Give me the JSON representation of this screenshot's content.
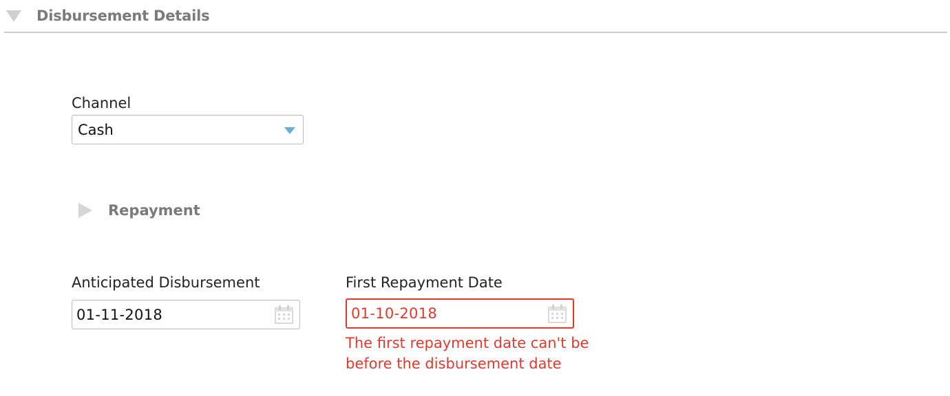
{
  "section": {
    "title": "Disbursement Details",
    "expanded_icon": "triangle-down-icon"
  },
  "channel": {
    "label": "Channel",
    "selected": "Cash",
    "caret_icon": "chevron-down-icon"
  },
  "repayment_section": {
    "title": "Repayment",
    "collapsed_icon": "triangle-right-icon"
  },
  "anticipated_disbursement": {
    "label": "Anticipated Disbursement",
    "value": "01-11-2018",
    "icon": "calendar-icon"
  },
  "first_repayment": {
    "label": "First Repayment Date",
    "value": "01-10-2018",
    "icon": "calendar-icon",
    "error_line1": "The first repayment date can't be",
    "error_line2": "before the disbursement date"
  },
  "colors": {
    "error": "#e03a2f",
    "caret": "#6aaed6",
    "muted_header": "#7a7a7a"
  }
}
